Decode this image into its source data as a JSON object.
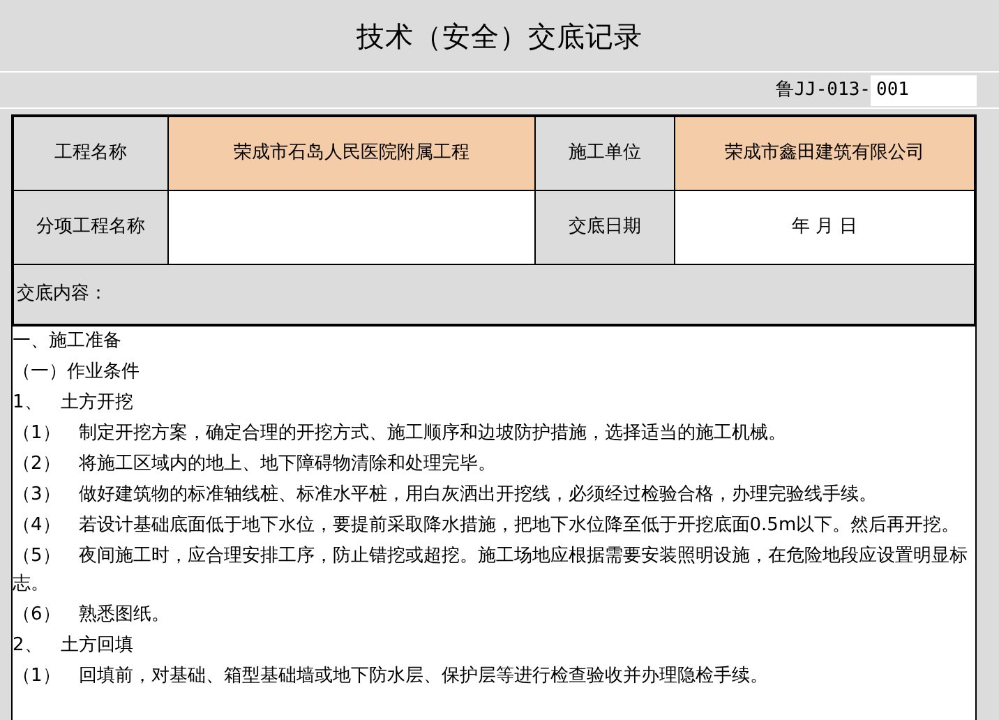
{
  "title": "技术（安全）交底记录",
  "record_code": {
    "prefix": "鲁JJ-013-",
    "value": "001"
  },
  "info_rows": [
    [
      {
        "label": "工程名称",
        "value": "荣成市石岛人民医院附属工程"
      },
      {
        "label": "施工单位",
        "value": "荣成市鑫田建筑有限公司"
      }
    ],
    [
      {
        "label": "分项工程名称"
      },
      {
        "label": "交底日期",
        "value": "年    月    日"
      }
    ]
  ],
  "content_label": "交底内容：",
  "content_lines": [
    "一、施工准备",
    "（一）作业条件",
    "1、　土方开挖",
    "（1）　制定开挖方案，确定合理的开挖方式、施工顺序和边坡防护措施，选择适当的施工机械。",
    "（2）　将施工区域内的地上、地下障碍物清除和处理完毕。",
    "（3）　做好建筑物的标准轴线桩、标准水平桩，用白灰洒出开挖线，必须经过检验合格，办理完验线手续。",
    "（4）　若设计基础底面低于地下水位，要提前采取降水措施，把地下水位降至低于开挖底面0.5m以下。然后再开挖。",
    "（5）　夜间施工时，应合理安排工序，防止错挖或超挖。施工场地应根据需要安装照明设施，在危险地段应设置明显标志。",
    "（6）　熟悉图纸。",
    "2、　土方回填",
    "（1）　回填前，对基础、箱型基础墙或地下防水层、保护层等进行检查验收并办理隐检手续。"
  ]
}
